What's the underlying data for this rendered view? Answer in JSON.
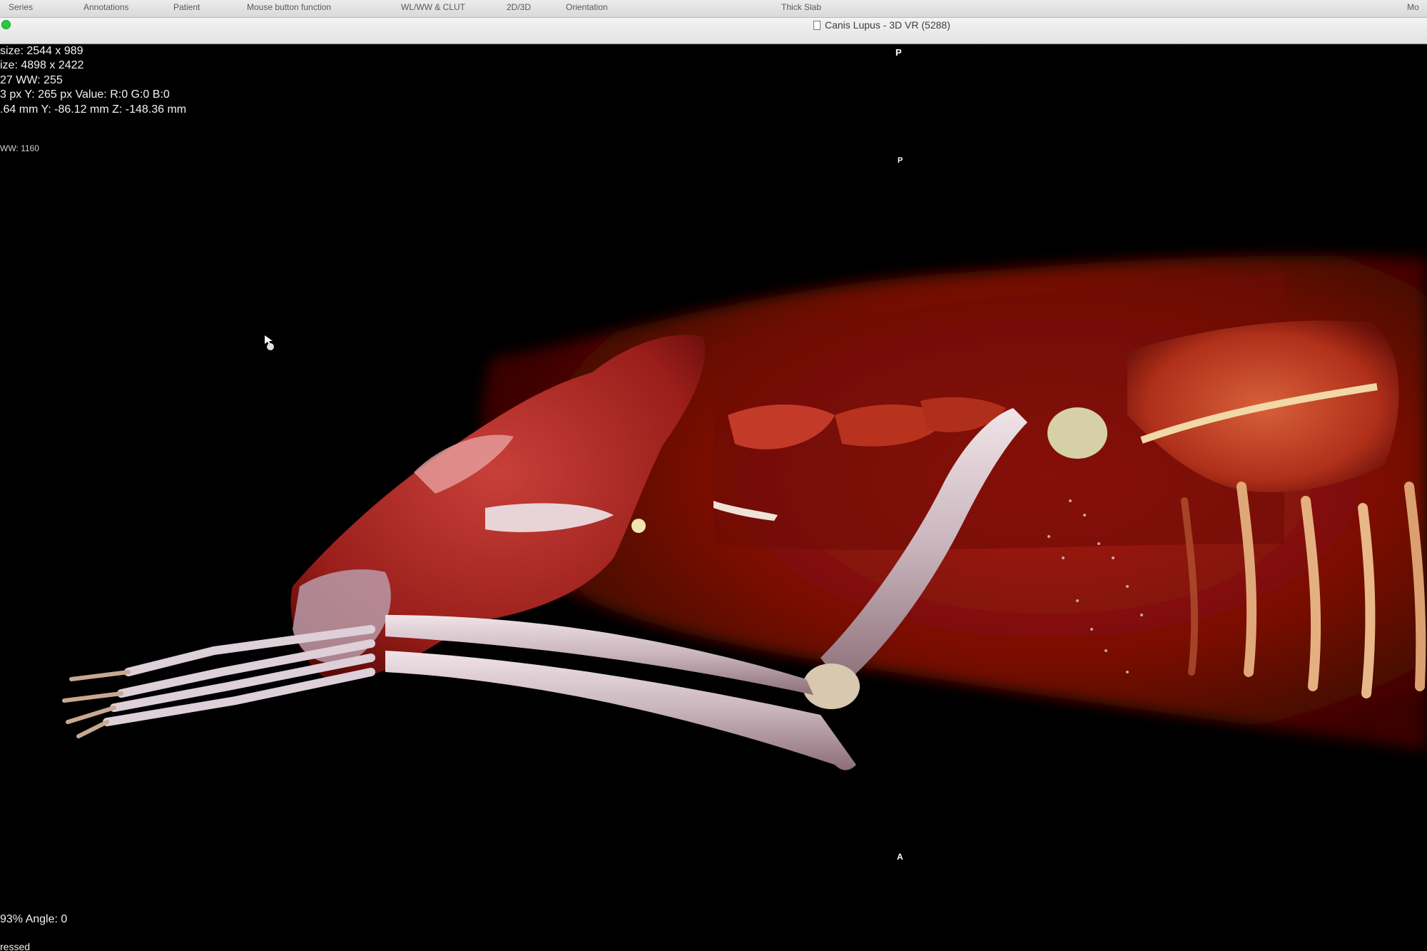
{
  "toolbar": {
    "items": [
      "Series",
      "Annotations",
      "Patient",
      "Mouse button function",
      "WL/WW & CLUT",
      "2D/3D",
      "Orientation",
      "Thick Slab",
      "Mo"
    ]
  },
  "window": {
    "title": "Canis Lupus - 3D VR (5288)"
  },
  "overlay": {
    "image_size": "size: 2544 x 989",
    "view_size": "ize: 4898 x 2422",
    "wl_ww": "27 WW: 255",
    "pixel_value": "3 px Y: 265 px Value: R:0 G:0 B:0",
    "mm_position": ".64 mm Y: -86.12 mm Z: -148.36 mm",
    "ww_small": "WW: 1160",
    "zoom_angle": "93% Angle: 0",
    "pressed": "ressed"
  },
  "orientation": {
    "top": "P",
    "top_inner": "P",
    "bottom": "A"
  },
  "colors": {
    "tissue": "#8e1208",
    "bone": "#d8c8cc",
    "background": "#000000",
    "status_light": "#27c93f"
  },
  "render": {
    "subject": "3D volume rendering of canine skull, foreleg and ribcage"
  }
}
